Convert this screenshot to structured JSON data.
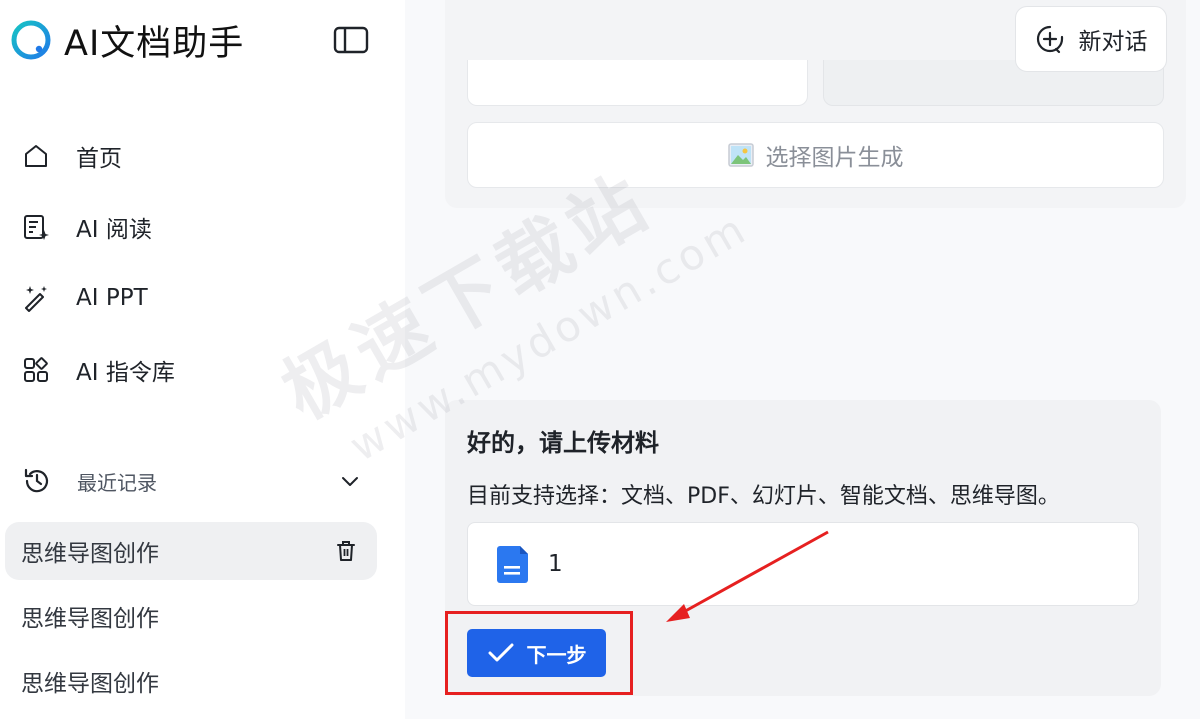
{
  "app": {
    "title": "AI文档助手"
  },
  "sidebar": {
    "nav": [
      {
        "label": "首页",
        "icon": "home-icon"
      },
      {
        "label": "AI 阅读",
        "icon": "document-sparkle-icon"
      },
      {
        "label": "AI PPT",
        "icon": "magic-wand-icon"
      },
      {
        "label": "AI 指令库",
        "icon": "grid-icon"
      }
    ],
    "recent": {
      "title": "最近记录",
      "items": [
        {
          "label": "思维导图创作",
          "active": true
        },
        {
          "label": "思维导图创作",
          "active": false
        },
        {
          "label": "思维导图创作",
          "active": false
        }
      ]
    }
  },
  "header": {
    "new_chat_label": "新对话"
  },
  "top_card": {
    "choose_image_label": "选择图片生成"
  },
  "reply": {
    "title": "好的，请上传材料",
    "description": "目前支持选择：文档、PDF、幻灯片、智能文档、思维导图。",
    "file_name": "1",
    "next_label": "下一步"
  },
  "watermark": {
    "cn": "极速下载站",
    "en": "www.mydown.com"
  },
  "colors": {
    "accent": "#1f63e8",
    "logo_gradient_start": "#19c2c9",
    "logo_gradient_end": "#1f63e8",
    "annotation": "#e62020"
  }
}
